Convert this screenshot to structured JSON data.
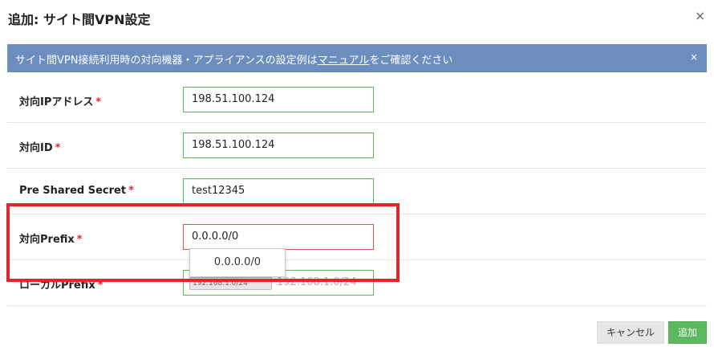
{
  "dialog": {
    "title": "追加: サイト間VPN設定",
    "close_icon": "×"
  },
  "banner": {
    "text_before": "サイト間VPN接続利用時の対向機器・アプライアンスの設定例は",
    "link_text": "マニュアル",
    "text_after": "をご確認ください",
    "close_icon": "×",
    "color": "#6c8ebf"
  },
  "required_mark": "*",
  "fields": [
    {
      "label": "対向IPアドレス",
      "value": "198.51.100.124"
    },
    {
      "label": "対向ID",
      "value": "198.51.100.124"
    },
    {
      "label": "Pre Shared Secret",
      "value": "test12345"
    },
    {
      "label": "対向Prefix",
      "value": "0.0.0.0/0"
    },
    {
      "label": "ローカルPrefix",
      "chip": "192.168.1.0/24",
      "placeholder": "192.168.1.0/24"
    }
  ],
  "suggestion": {
    "value": "0.0.0.0/0"
  },
  "buttons": {
    "cancel": "キャンセル",
    "add": "追加"
  },
  "colors": {
    "valid_border": "#5cb85c",
    "focused_border": "#d9534f",
    "required": "#e0262f",
    "highlight": "#e5252a",
    "add_button": "#5cb85c"
  }
}
